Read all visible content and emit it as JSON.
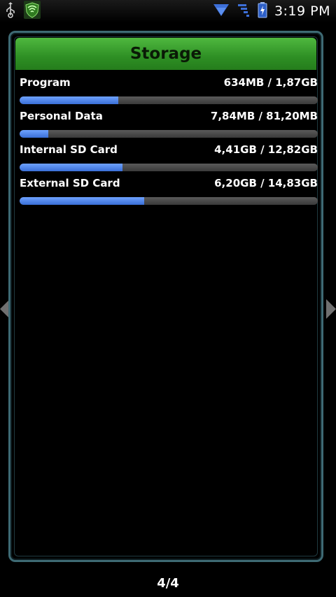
{
  "status_bar": {
    "clock": "3:19 PM",
    "icons": [
      "usb-icon",
      "shield-app-icon",
      "wifi-icon",
      "signal-icon",
      "battery-charging-icon"
    ]
  },
  "panel": {
    "title": "Storage",
    "rows": [
      {
        "label": "Program",
        "value": "634MB / 1,87GB",
        "usage_fraction": 0.33
      },
      {
        "label": "Personal Data",
        "value": "7,84MB / 81,20MB",
        "usage_fraction": 0.097
      },
      {
        "label": "Internal SD Card",
        "value": "4,41GB / 12,82GB",
        "usage_fraction": 0.344
      },
      {
        "label": "External SD Card",
        "value": "6,20GB / 14,83GB",
        "usage_fraction": 0.418
      }
    ]
  },
  "page_indicator": "4/4",
  "colors": {
    "header_green": "#3aa52e",
    "bar_blue": "#4a80e8",
    "frame": "#3e6a74"
  }
}
